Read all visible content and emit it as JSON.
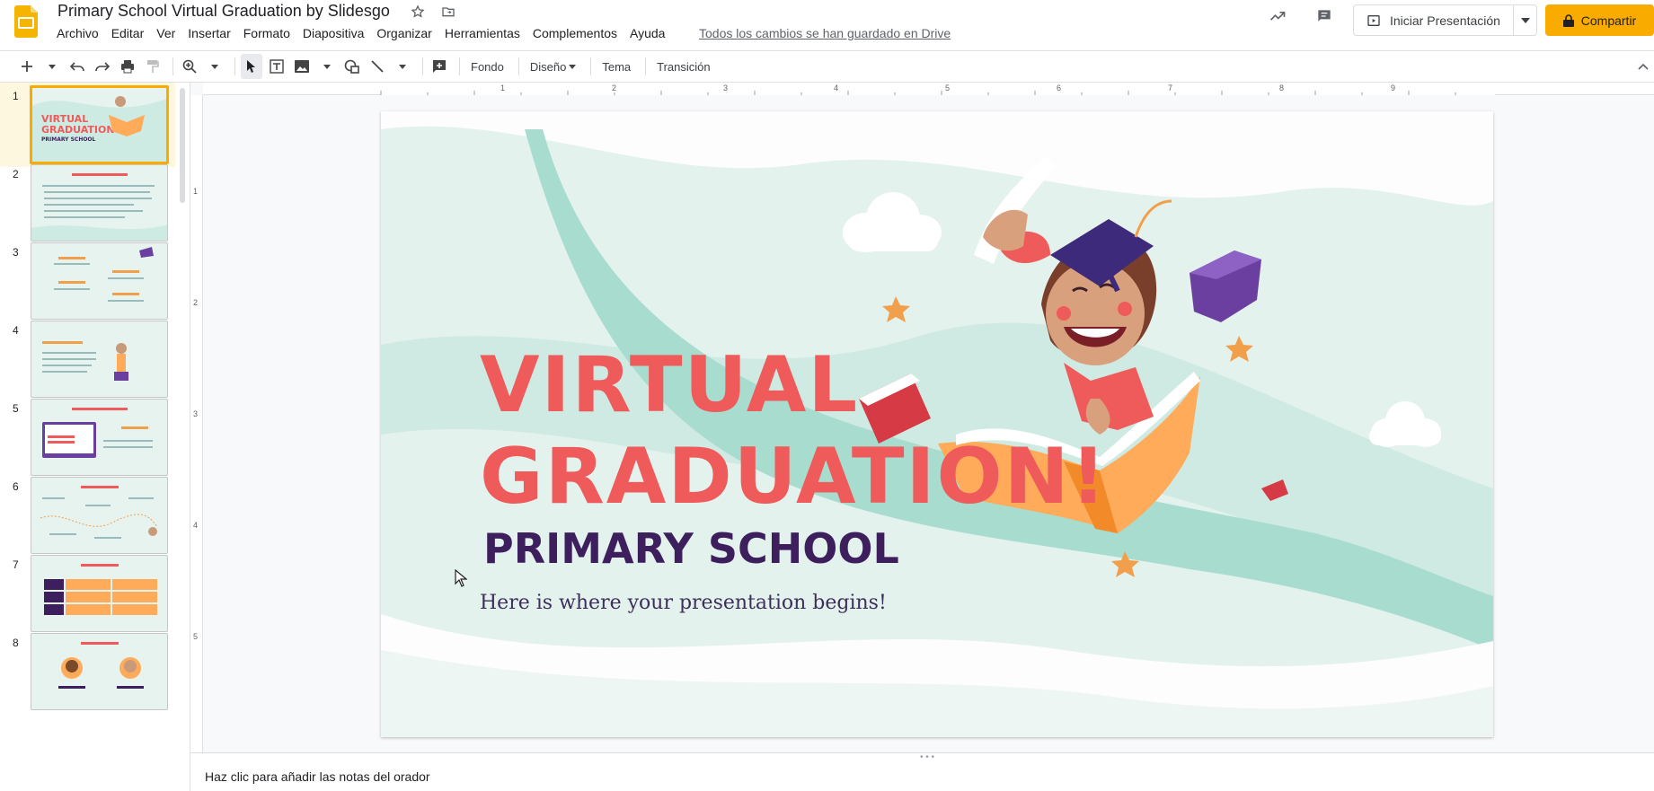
{
  "document": {
    "title": "Primary School Virtual Graduation by Slidesgo",
    "saved_status": "Todos los cambios se han guardado en Drive"
  },
  "menu": [
    "Archivo",
    "Editar",
    "Ver",
    "Insertar",
    "Formato",
    "Diapositiva",
    "Organizar",
    "Herramientas",
    "Complementos",
    "Ayuda"
  ],
  "header_actions": {
    "present_label": "Iniciar Presentación",
    "share_label": "Compartir"
  },
  "toolbar": {
    "background_label": "Fondo",
    "layout_label": "Diseño",
    "theme_label": "Tema",
    "transition_label": "Transición"
  },
  "filmstrip": {
    "slides": [
      {
        "number": "1"
      },
      {
        "number": "2"
      },
      {
        "number": "3"
      },
      {
        "number": "4"
      },
      {
        "number": "5"
      },
      {
        "number": "6"
      },
      {
        "number": "7"
      },
      {
        "number": "8"
      }
    ]
  },
  "ruler": {
    "horizontal": [
      "1",
      "2",
      "3",
      "4",
      "5",
      "6",
      "7",
      "8",
      "9"
    ],
    "vertical": [
      "1",
      "2",
      "3",
      "4",
      "5"
    ]
  },
  "slide": {
    "title_line1": "VIRTUAL",
    "title_line2": "GRADUATION!",
    "subtitle": "PRIMARY SCHOOL",
    "body": "Here is where your presentation begins!"
  },
  "notes": {
    "placeholder": "Haz clic para añadir las notas del orador"
  },
  "colors": {
    "accent_share": "#f9ab00",
    "slide_title": "#ef5a5a",
    "slide_subtitle": "#3d1f5e",
    "slide_bg": "#e7f3ef",
    "wave": "#a8dccf"
  }
}
